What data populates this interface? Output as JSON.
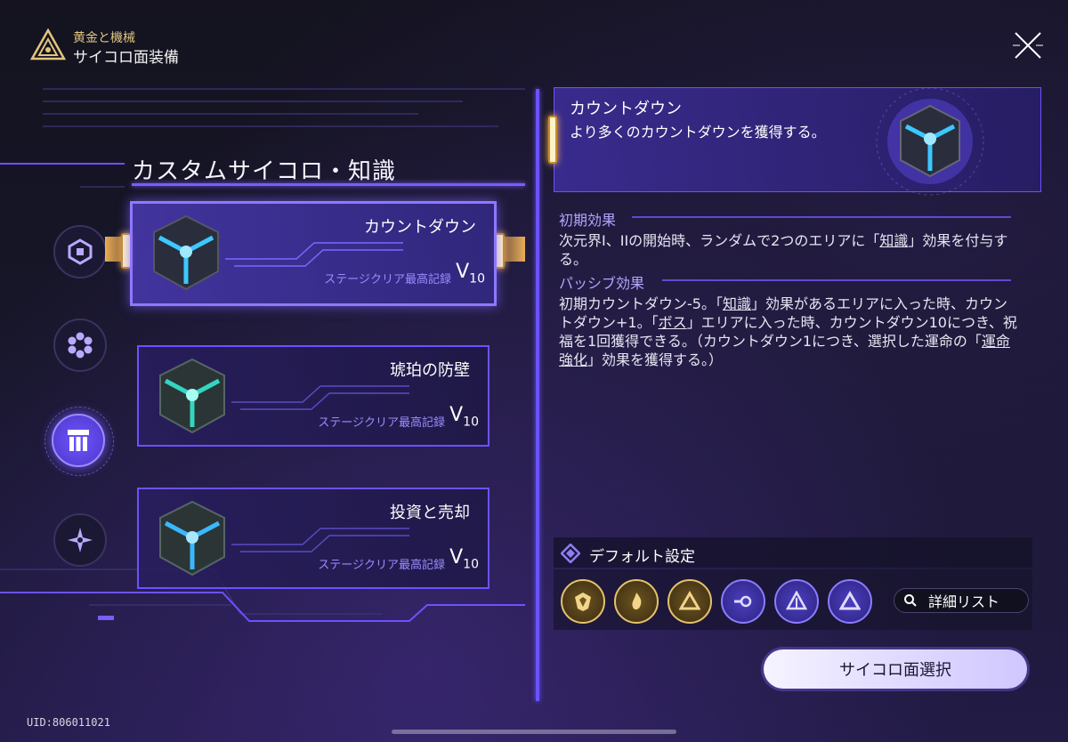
{
  "header": {
    "subtitle": "黄金と機械",
    "title": "サイコロ面装備"
  },
  "section": {
    "title": "カスタムサイコロ・知識"
  },
  "categories": [
    {
      "name": "dice-hex-icon",
      "active": false
    },
    {
      "name": "flower-icon",
      "active": false
    },
    {
      "name": "pillars-icon",
      "active": true
    },
    {
      "name": "star-icon",
      "active": false
    }
  ],
  "dice_cards": [
    {
      "name": "カウントダウン",
      "record_label": "ステージクリア最高記録",
      "record_letter": "V",
      "record_level": "10",
      "selected": true
    },
    {
      "name": "琥珀の防壁",
      "record_label": "ステージクリア最高記録",
      "record_letter": "V",
      "record_level": "10",
      "selected": false
    },
    {
      "name": "投資と売却",
      "record_label": "ステージクリア最高記録",
      "record_letter": "V",
      "record_level": "10",
      "selected": false
    }
  ],
  "detail": {
    "name": "カウントダウン",
    "description": "より多くのカウントダウンを獲得する。",
    "initial_heading": "初期効果",
    "initial_text_1": "次元界I、IIの開始時、ランダムで2つのエリアに「",
    "initial_text_u": "知識",
    "initial_text_2": "」効果を付与する。",
    "passive_heading": "パッシブ効果",
    "passive_p1": "初期カウントダウン-5。「",
    "passive_u1": "知識",
    "passive_p2": "」効果があるエリアに入った時、カウントダウン+1。「",
    "passive_u2": "ボス",
    "passive_p3": "」エリアに入った時、カウントダウン10につき、祝福を1回獲得できる。（カウントダウン1につき、選択した運命の「",
    "passive_u3": "運命強化",
    "passive_p4": "」効果を獲得する。）"
  },
  "defaults": {
    "label": "デフォルト設定",
    "slots": [
      {
        "icon": "shield-crest-icon",
        "tone": "gold"
      },
      {
        "icon": "flame-icon",
        "tone": "gold"
      },
      {
        "icon": "triangle-icon",
        "tone": "gold"
      },
      {
        "icon": "key-icon",
        "tone": "purple"
      },
      {
        "icon": "tree-triangle-icon",
        "tone": "purple"
      },
      {
        "icon": "triangle-icon",
        "tone": "purple"
      }
    ],
    "detail_button": "詳細リスト"
  },
  "select_button": "サイコロ面選択",
  "uid": "UID:806011021",
  "colors": {
    "accent": "#6b52ff",
    "gold": "#e6c26b",
    "highlight_text": "#b4a4ff"
  }
}
